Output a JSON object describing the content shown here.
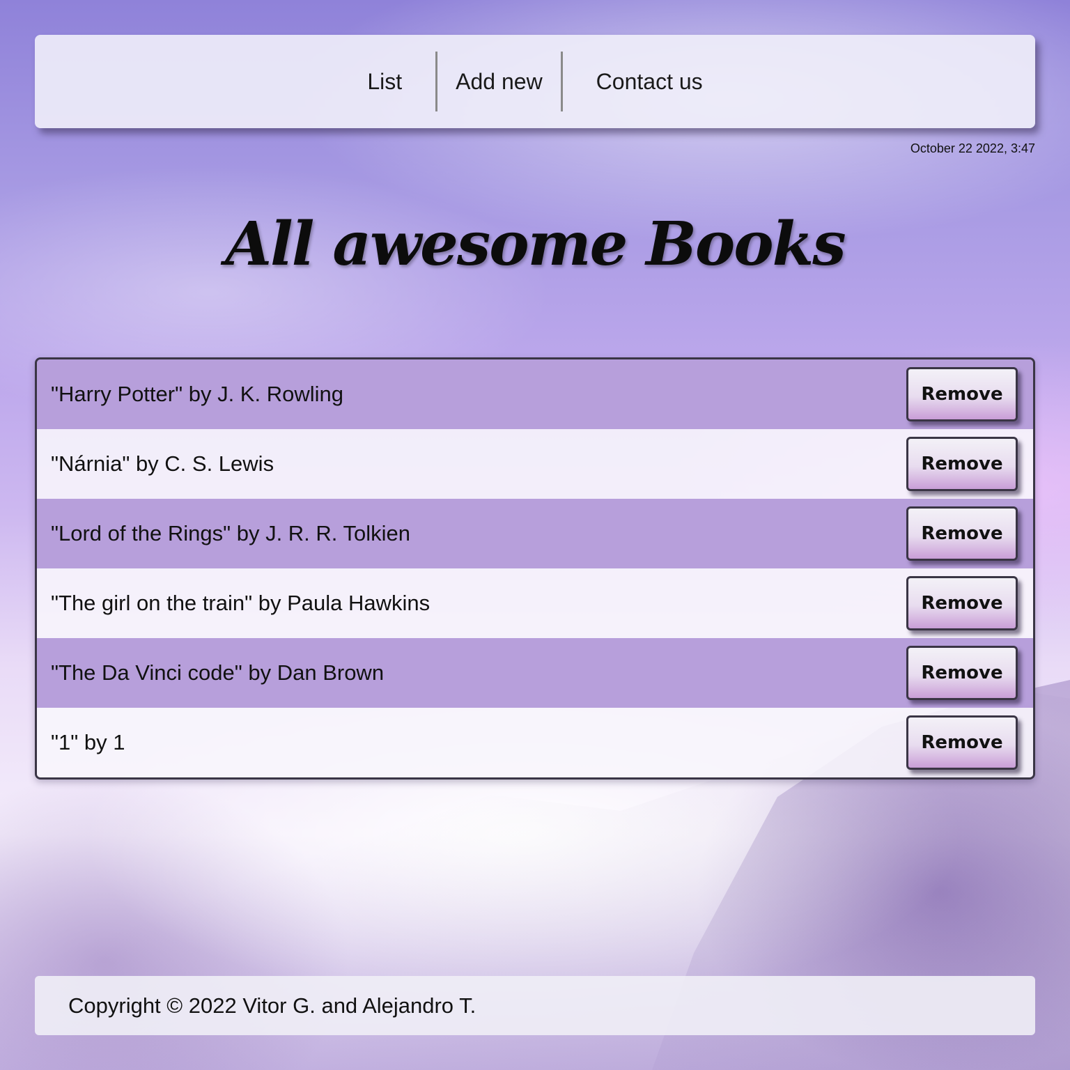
{
  "nav": {
    "items": [
      {
        "label": "List"
      },
      {
        "label": "Add new"
      },
      {
        "label": "Contact us"
      }
    ]
  },
  "date": "October 22 2022, 3:47",
  "title": "All awesome Books",
  "books": [
    {
      "text": "\"Harry Potter\"  by J. K. Rowling",
      "button": "Remove"
    },
    {
      "text": "\"Nárnia\"  by C. S. Lewis",
      "button": "Remove"
    },
    {
      "text": "\"Lord of the Rings\"  by J. R. R. Tolkien",
      "button": "Remove"
    },
    {
      "text": "\"The girl on the train\"  by Paula Hawkins",
      "button": "Remove"
    },
    {
      "text": "\"The Da Vinci code\"  by Dan Brown",
      "button": "Remove"
    },
    {
      "text": "\"1\"  by 1",
      "button": "Remove"
    }
  ],
  "footer": {
    "text": "Copyright © 2022 Vitor G. and Alejandro T."
  },
  "colors": {
    "row_highlight": "#b79fdb",
    "border": "#3a3545"
  }
}
